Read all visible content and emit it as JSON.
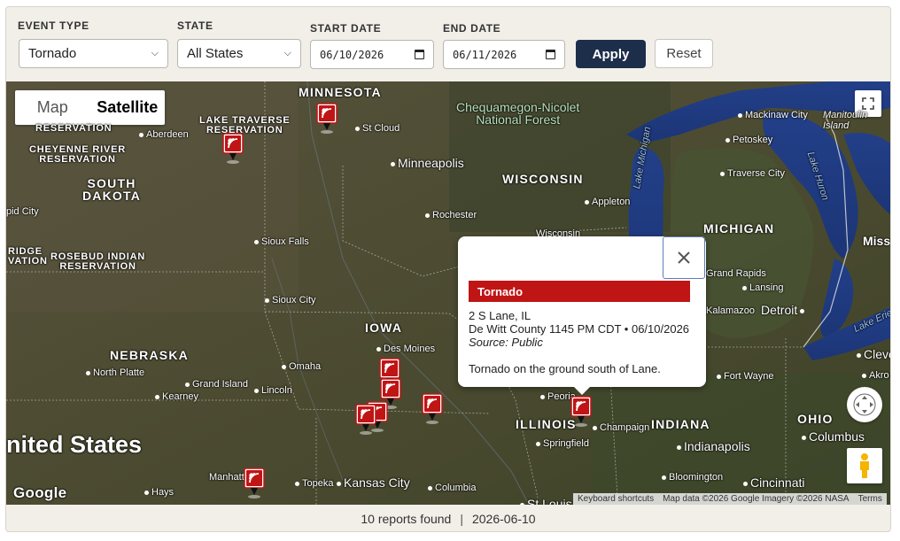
{
  "filters": {
    "event_type": {
      "label": "EVENT TYPE",
      "value": "Tornado"
    },
    "state": {
      "label": "STATE",
      "value": "All States"
    },
    "start_date": {
      "label": "START DATE",
      "value": "06/10/2026"
    },
    "end_date": {
      "label": "END DATE",
      "value": "06/11/2026"
    },
    "apply_label": "Apply",
    "reset_label": "Reset"
  },
  "map": {
    "type_control": {
      "map": "Map",
      "satellite": "Satellite",
      "selected": "Satellite"
    },
    "labels": {
      "minnesota": "MINNESOTA",
      "wisconsin": "WISCONSIN",
      "michigan": "MICHIGAN",
      "south_dakota": "SOUTH\nDAKOTA",
      "iowa": "IOWA",
      "nebraska": "NEBRASKA",
      "illinois": "ILLINOIS",
      "indiana": "INDIANA",
      "ohio": "OHIO",
      "miss": "Miss",
      "lake_traverse": "LAKE TRAVERSE\nRESERVATION",
      "cheyenne_river": "CHEYENNE RIVER\nRESERVATION",
      "reservation_top": "RESERVATION",
      "rosebud": "ROSEBUD INDIAN\nRESERVATION",
      "ridge": "RIDGE\nVATION",
      "forest": "Chequamegon-Nicolet\nNational Forest",
      "united_states": "nited States",
      "lake_michigan": "Lake Michigan",
      "lake_huron": "Lake Huron",
      "lake_erie": "Lake Erie",
      "aberdeen": "Aberdeen",
      "st_cloud": "St Cloud",
      "minneapolis": "Minneapolis",
      "rochester": "Rochester",
      "appleton": "Appleton",
      "wisconsin_city": "Wisconsin",
      "sioux_falls": "Sioux Falls",
      "sioux_city": "Sioux City",
      "des_moines": "Des Moines",
      "omaha": "Omaha",
      "lincoln": "Lincoln",
      "north_platte": "North Platte",
      "grand_island": "Grand Island",
      "kearney": "Kearney",
      "manhattan": "Manhatt",
      "hays": "Hays",
      "topeka": "Topeka",
      "kansas_city": "Kansas City",
      "columbia": "Columbia",
      "st_louis": "St Louis",
      "peoria": "Peoria",
      "springfield": "Springfield",
      "champaign": "Champaign",
      "indianapolis": "Indianapolis",
      "bloomington": "Bloomington",
      "cincinnati": "Cincinnati",
      "columbus": "Columbus",
      "fort_wayne": "Fort Wayne",
      "kalamazoo": "Kalamazoo",
      "detroit": "Detroit",
      "lansing": "Lansing",
      "grand_rapids": "Grand Rapids",
      "traverse_city": "Traverse City",
      "petoskey": "Petoskey",
      "mackinaw": "Mackinaw City",
      "manitoulin": "Manitoulin\nIsland",
      "pid_city": "pid City",
      "cleve": "Cleve",
      "akro": "Akro"
    },
    "attribution": {
      "shortcuts": "Keyboard shortcuts",
      "data": "Map data ©2026 Google Imagery ©2026 NASA",
      "terms": "Terms"
    },
    "google_logo": "Google"
  },
  "popup": {
    "event": "Tornado",
    "location": "2 S Lane, IL",
    "details": "De Witt County 1145 PM CDT • 06/10/2026",
    "source": "Source: Public",
    "description": "Tornado on the ground south of Lane."
  },
  "status": {
    "count": "10 reports found",
    "separator": "|",
    "date": "2026-06-10"
  },
  "colors": {
    "apply": "#1c2e4a",
    "marker": "#c01515",
    "event_bar": "#c01515"
  }
}
